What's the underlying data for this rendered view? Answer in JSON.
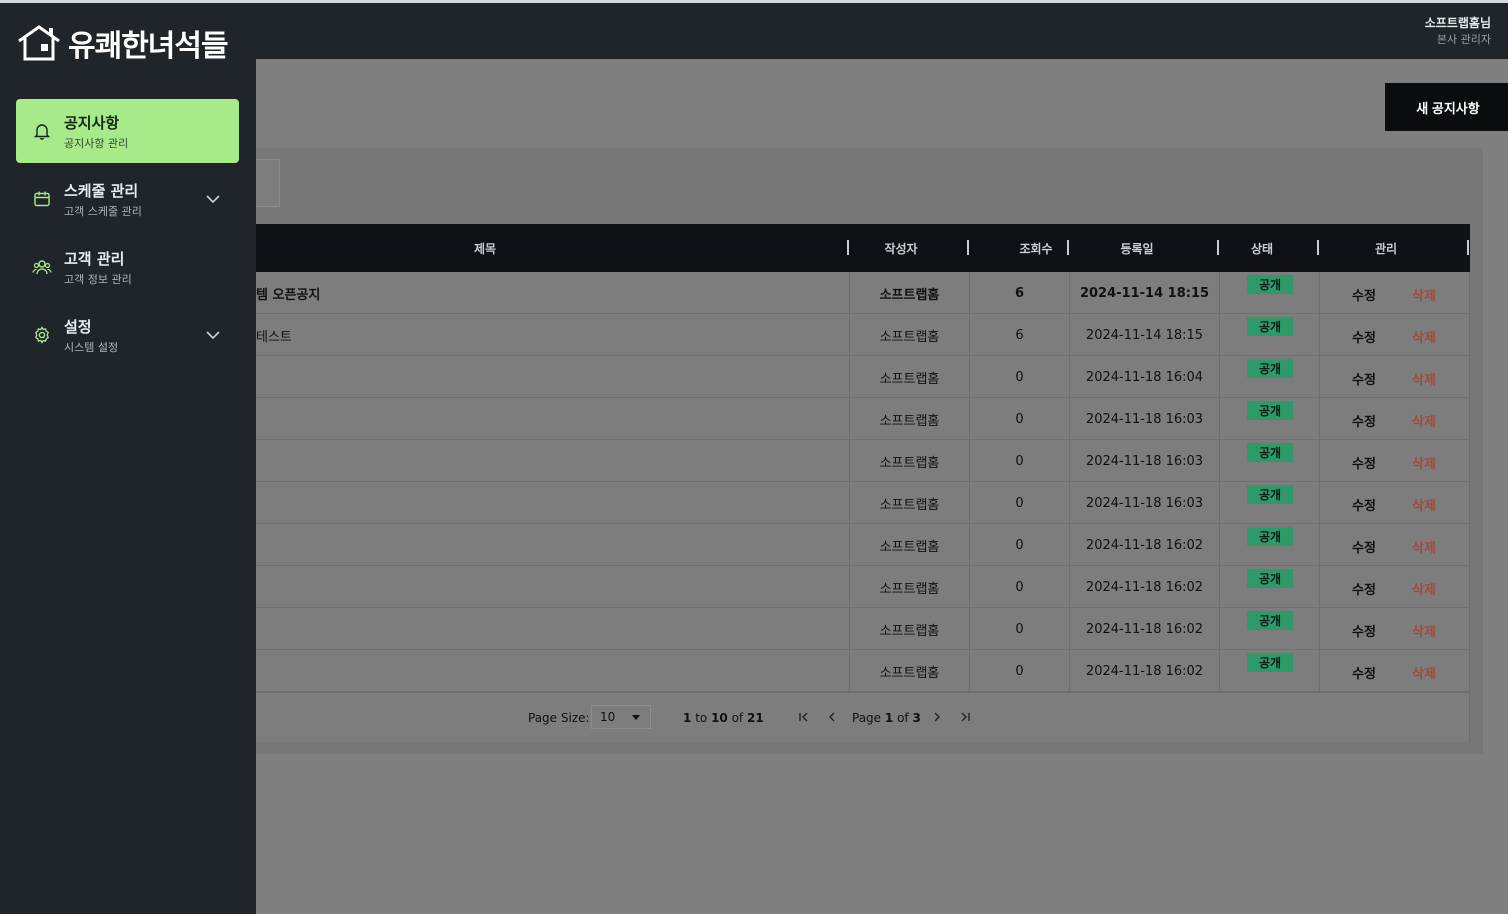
{
  "header": {
    "user_name": "소프트랩홈님",
    "user_role": "본사 관리자"
  },
  "brand": {
    "name": "유쾌한녀석들",
    "logo_icon": "house-logo-icon"
  },
  "sidebar": {
    "items": [
      {
        "label": "공지사항",
        "sub": "공지사항 관리",
        "icon": "bell-icon",
        "active": true,
        "expandable": false
      },
      {
        "label": "스케줄 관리",
        "sub": "고객 스케줄 관리",
        "icon": "calendar-icon",
        "active": false,
        "expandable": true
      },
      {
        "label": "고객 관리",
        "sub": "고객 정보 관리",
        "icon": "users-icon",
        "active": false,
        "expandable": false
      },
      {
        "label": "설정",
        "sub": "시스템 설정",
        "icon": "gear-icon",
        "active": false,
        "expandable": true
      }
    ]
  },
  "toolbar": {
    "new_notice": "새 공지사항"
  },
  "grid": {
    "columns": [
      "제목",
      "작성자",
      "조회수",
      "등록일",
      "상태",
      "관리"
    ],
    "rows": [
      {
        "title": "템 오픈공지",
        "author": "소프트랩홈",
        "views": "6",
        "date": "2024-11-14 18:15",
        "status": "공개",
        "edit": "수정",
        "delete": "삭제",
        "bold": true
      },
      {
        "title": "테스트",
        "author": "소프트랩홈",
        "views": "6",
        "date": "2024-11-14 18:15",
        "status": "공개",
        "edit": "수정",
        "delete": "삭제",
        "bold": false
      },
      {
        "title": "",
        "author": "소프트랩홈",
        "views": "0",
        "date": "2024-11-18 16:04",
        "status": "공개",
        "edit": "수정",
        "delete": "삭제",
        "bold": false
      },
      {
        "title": "",
        "author": "소프트랩홈",
        "views": "0",
        "date": "2024-11-18 16:03",
        "status": "공개",
        "edit": "수정",
        "delete": "삭제",
        "bold": false
      },
      {
        "title": "",
        "author": "소프트랩홈",
        "views": "0",
        "date": "2024-11-18 16:03",
        "status": "공개",
        "edit": "수정",
        "delete": "삭제",
        "bold": false
      },
      {
        "title": "",
        "author": "소프트랩홈",
        "views": "0",
        "date": "2024-11-18 16:03",
        "status": "공개",
        "edit": "수정",
        "delete": "삭제",
        "bold": false
      },
      {
        "title": "",
        "author": "소프트랩홈",
        "views": "0",
        "date": "2024-11-18 16:02",
        "status": "공개",
        "edit": "수정",
        "delete": "삭제",
        "bold": false
      },
      {
        "title": "",
        "author": "소프트랩홈",
        "views": "0",
        "date": "2024-11-18 16:02",
        "status": "공개",
        "edit": "수정",
        "delete": "삭제",
        "bold": false
      },
      {
        "title": "",
        "author": "소프트랩홈",
        "views": "0",
        "date": "2024-11-18 16:02",
        "status": "공개",
        "edit": "수정",
        "delete": "삭제",
        "bold": false
      },
      {
        "title": "",
        "author": "소프트랩홈",
        "views": "0",
        "date": "2024-11-18 16:02",
        "status": "공개",
        "edit": "수정",
        "delete": "삭제",
        "bold": false
      }
    ]
  },
  "pagination": {
    "page_size_label": "Page Size:",
    "page_size": "10",
    "range_from": "1",
    "range_to_word": "to",
    "range_to": "10",
    "of_word": "of",
    "total": "21",
    "page_word": "Page",
    "current_page": "1",
    "total_pages": "3"
  },
  "colors": {
    "sidebar_bg": "#20242b",
    "active_item": "#a7ea8a",
    "badge_public": "#2e9a6a",
    "delete_text": "#a6483a",
    "overlay_bg": "#7f7f7f"
  }
}
